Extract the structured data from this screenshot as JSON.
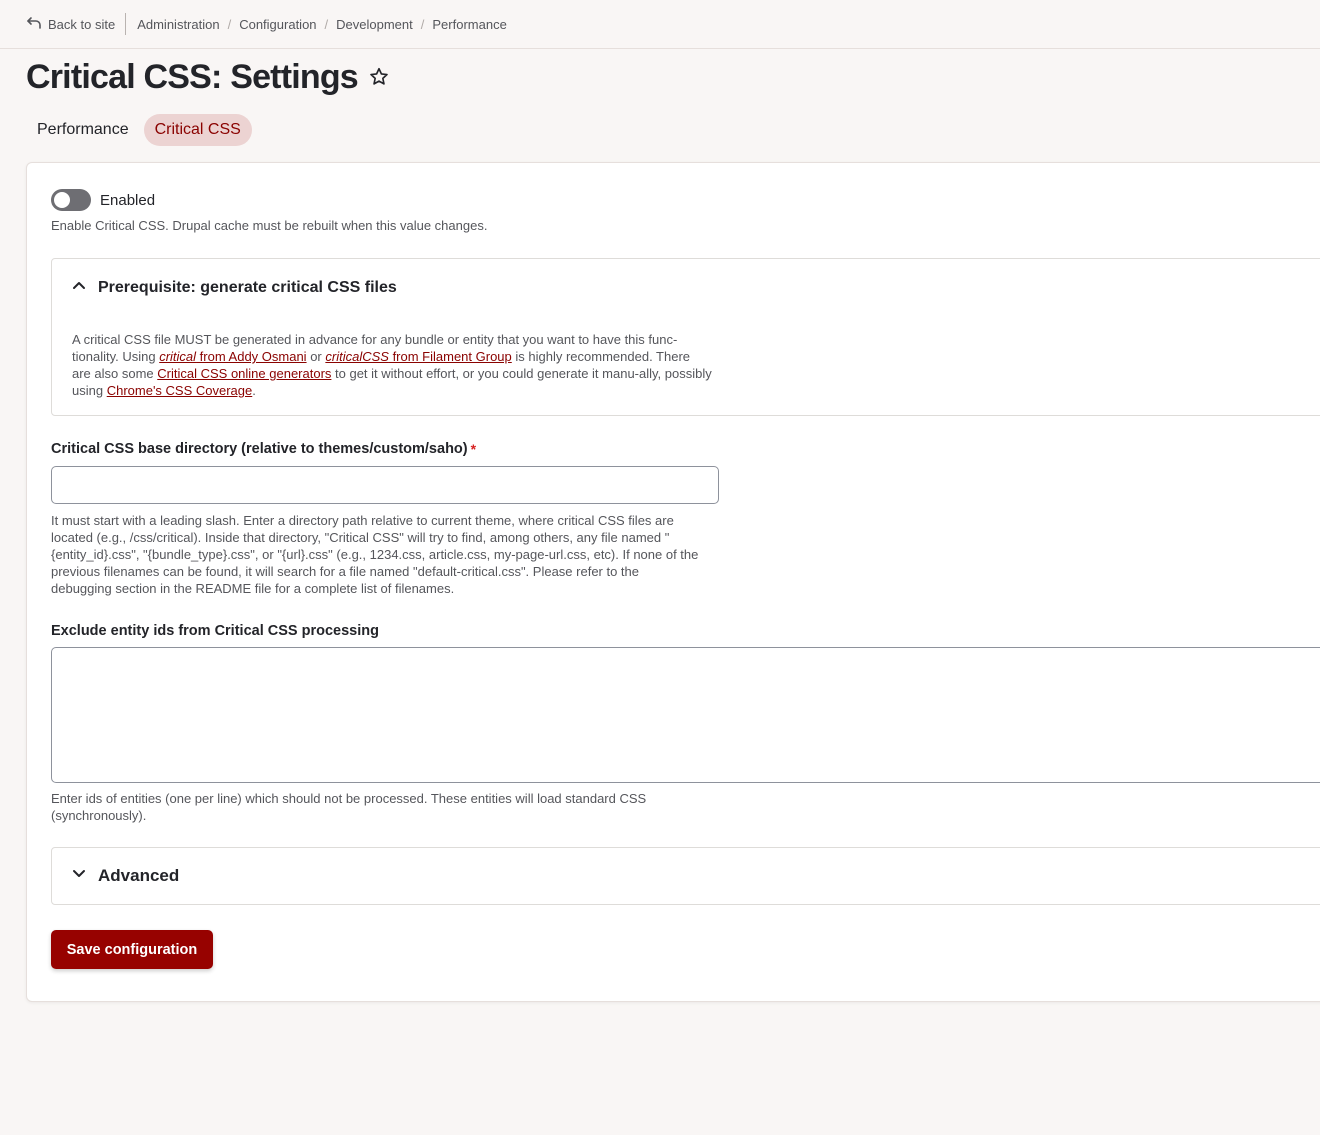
{
  "topbar": {
    "back_label": "Back to site",
    "breadcrumbs": [
      "Administration",
      "Configuration",
      "Development",
      "Performance"
    ]
  },
  "page": {
    "title": "Critical CSS: Settings"
  },
  "tabs": [
    {
      "label": "Performance",
      "active": false
    },
    {
      "label": "Critical CSS",
      "active": true
    }
  ],
  "form": {
    "enabled": {
      "label": "Enabled",
      "checked": false,
      "description": "Enable Critical CSS. Drupal cache must be rebuilt when this value changes."
    },
    "prereq": {
      "summary": "Prerequisite: generate critical CSS files",
      "expanded": true,
      "text_1": "A critical CSS file MUST be generated in advance for any bundle or entity that you want to have this func-tionality. Using ",
      "link_critical_em": "critical",
      "link_critical_rest": " from Addy Osmani",
      "text_or": " or ",
      "link_criticalcss_em": "criticalCSS",
      "link_criticalcss_rest": " from Filament Group",
      "text_2": " is highly recommended. There are also some ",
      "link_online": "Critical CSS online generators",
      "text_3": " to get it without effort, or you could generate it manu-ally, possibly using ",
      "link_chrome": "Chrome's CSS Coverage",
      "text_4": "."
    },
    "base_dir": {
      "label": "Critical CSS base directory (relative to themes/custom/saho)",
      "required_mark": "*",
      "value": "",
      "description": "It must start with a leading slash. Enter a directory path relative to current theme, where critical CSS files are located (e.g., /css/critical). Inside that directory, \"Critical CSS\" will try to find, among others, any file named \"{entity_id}.css\", \"{bundle_type}.css\", or \"{url}.css\" (e.g., 1234.css, article.css, my-page-url.css, etc). If none of the previous filenames can be found, it will search for a file named \"default-critical.css\". Please refer to the debugging section in the README file for a complete list of filenames."
    },
    "exclude": {
      "label": "Exclude entity ids from Critical CSS processing",
      "value": "",
      "description": "Enter ids of entities (one per line) which should not be processed. These entities will load standard CSS (synchronously)."
    },
    "advanced": {
      "summary": "Advanced",
      "expanded": false
    },
    "save_label": "Save configuration"
  },
  "colors": {
    "brand": "#970200",
    "tab_active_bg": "#ecd3d2",
    "background": "#f9f6f5"
  },
  "icons": {
    "back": "arrow-return-left-icon",
    "favorite": "star-outline-icon",
    "prereq_toggle": "chevron-up-icon",
    "advanced_toggle": "chevron-down-icon"
  }
}
